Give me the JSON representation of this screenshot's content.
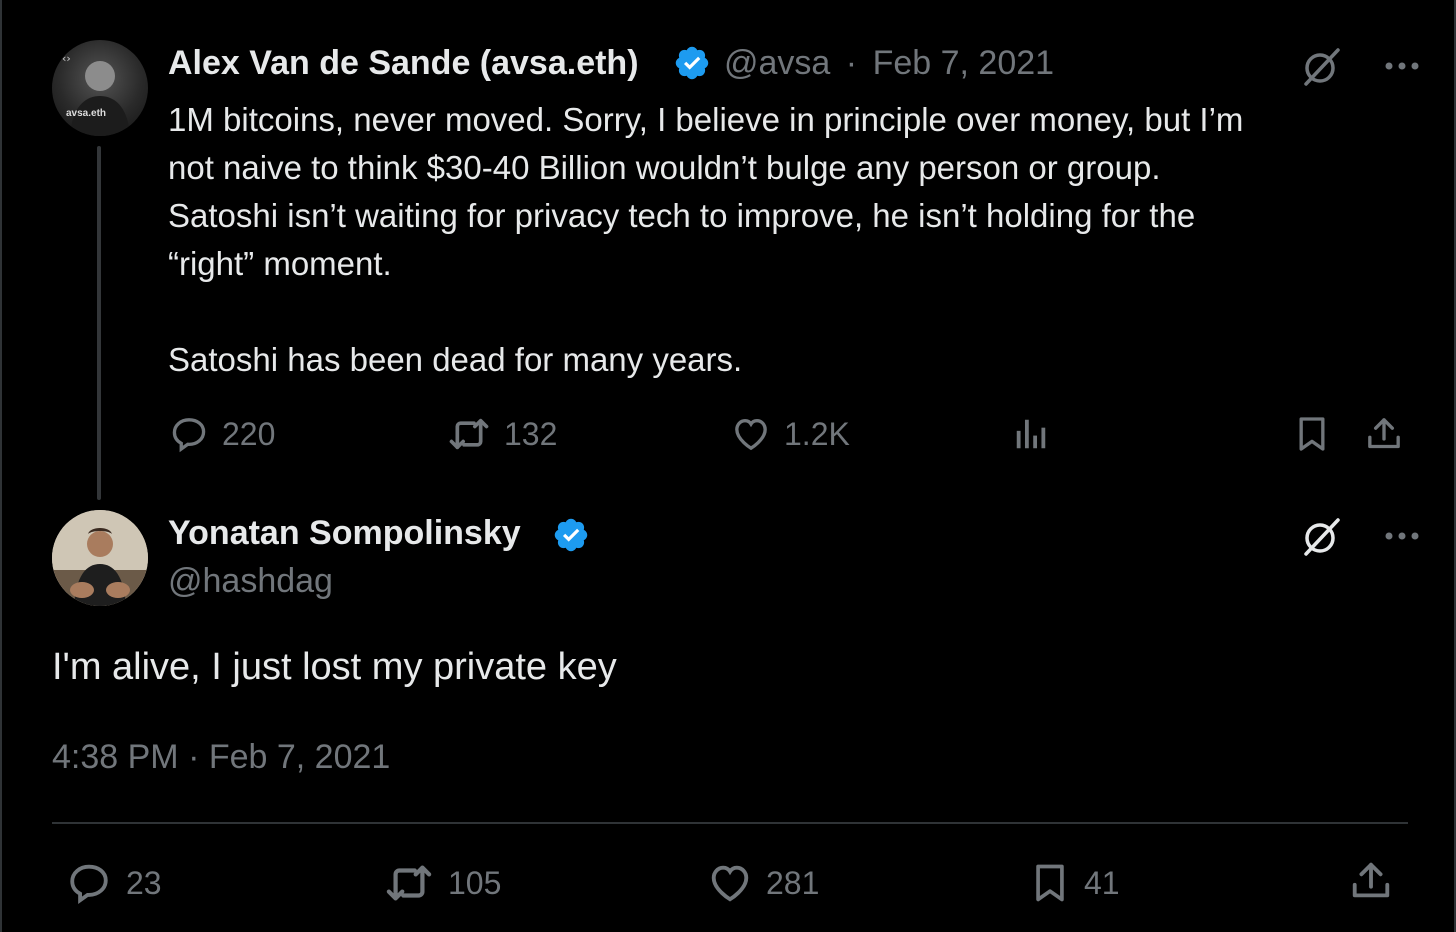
{
  "parent_tweet": {
    "author_name": "Alex Van de Sande (avsa.eth)",
    "avatar_label": "avsa.eth",
    "handle": "@avsa",
    "separator": "·",
    "date": "Feb 7, 2021",
    "text": "1M bitcoins, never moved. Sorry, I believe in principle over money, but I’m\nnot naive to think $30-40 Billion wouldn’t bulge any person or group.\nSatoshi isn’t waiting for privacy tech to improve, he isn’t holding for the\n“right” moment.\n\nSatoshi has been dead for many years.",
    "stats": {
      "replies": "220",
      "reposts": "132",
      "likes": "1.2K"
    }
  },
  "main_tweet": {
    "author_name": "Yonatan Sompolinsky",
    "handle": "@hashdag",
    "text": "I'm alive, I just lost my private key",
    "timestamp": "4:38 PM · Feb 7, 2021",
    "stats": {
      "replies": "23",
      "reposts": "105",
      "likes": "281",
      "bookmarks": "41"
    }
  },
  "colors": {
    "background": "#000000",
    "text": "#e7e9ea",
    "muted": "#71767b",
    "verified": "#1d9bf0",
    "divider": "#2f3336"
  },
  "icons": [
    "comment-icon",
    "repost-icon",
    "heart-icon",
    "analytics-icon",
    "bookmark-icon",
    "share-icon",
    "grok-icon",
    "more-icon",
    "verified-badge-icon"
  ]
}
